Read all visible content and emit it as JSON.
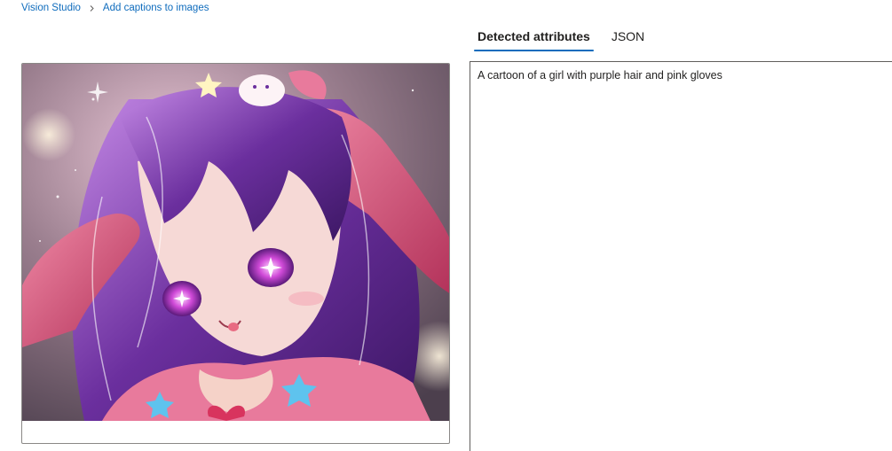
{
  "breadcrumb": {
    "items": [
      {
        "label": "Vision Studio"
      },
      {
        "label": "Add captions to images"
      }
    ]
  },
  "tabs": [
    {
      "label": "Detected attributes",
      "active": true
    },
    {
      "label": "JSON",
      "active": false
    }
  ],
  "result": {
    "caption": "A cartoon of a girl with purple hair and pink gloves"
  },
  "image": {
    "palette": {
      "hair": "#6b2f9e",
      "hair_light": "#b06fd6",
      "skin": "#f6d9d6",
      "glove": "#d94a6e",
      "dress": "#e87a9c",
      "bg": "#7d6a78",
      "accent": "#0f6cbd"
    }
  }
}
